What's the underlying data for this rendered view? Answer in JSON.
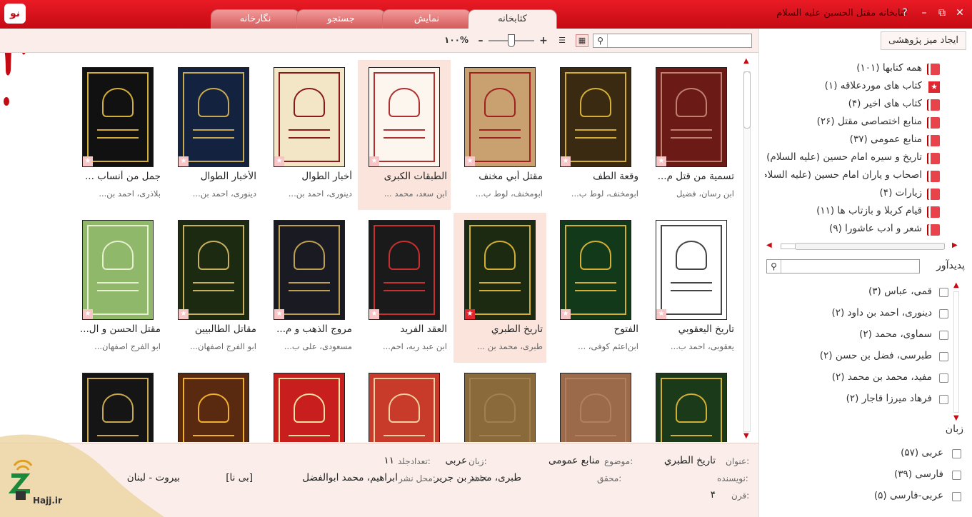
{
  "app": {
    "title": "کتابخانه مقتل الحسین علیه السلام",
    "logo_text": "نو",
    "help_icon": "?"
  },
  "tabs": [
    {
      "label": "کتابخانه",
      "active": true
    },
    {
      "label": "نمایش",
      "active": false
    },
    {
      "label": "جستجو",
      "active": false
    },
    {
      "label": "نگارخانه",
      "active": false
    }
  ],
  "toolbar": {
    "search_placeholder": "",
    "zoom": "۱۰۰%",
    "zoom_fraction": 0.45
  },
  "books": [
    {
      "title": "تسمية من قتل م...",
      "author": "ابن رسان، فضيل",
      "fav": false,
      "selected": false,
      "cover": "#6b1a16",
      "accent": "#c08070"
    },
    {
      "title": "وقعة الطف",
      "author": "ابومخنف، لوط ب...",
      "fav": false,
      "selected": false,
      "cover": "#3a2a12",
      "accent": "#d4af37"
    },
    {
      "title": "مقتل أبي مخنف",
      "author": "ابومخنف، لوط ب...",
      "fav": false,
      "selected": false,
      "cover": "#c9a070",
      "accent": "#a02020"
    },
    {
      "title": "الطبقات الكبرى",
      "author": "ابن سعد، محمد ...",
      "fav": false,
      "selected": true,
      "cover": "#fdf6ef",
      "accent": "#b03030"
    },
    {
      "title": "أخبار الطوال",
      "author": "دینوری، احمد بن...",
      "fav": false,
      "selected": false,
      "cover": "#f3e6c6",
      "accent": "#8a1a1a"
    },
    {
      "title": "الأخبار الطوال",
      "author": "دینوری، احمد بن...",
      "fav": false,
      "selected": false,
      "cover": "#13233f",
      "accent": "#c9a850"
    },
    {
      "title": "جمل من أنساب ...",
      "author": "بلاذری، احمد بن...",
      "fav": false,
      "selected": false,
      "cover": "#111111",
      "accent": "#d4af37"
    },
    {
      "title": "تاريخ اليعقوبي",
      "author": "یعقوبی، احمد ب...",
      "fav": false,
      "selected": false,
      "cover": "#ffffff",
      "accent": "#444444"
    },
    {
      "title": "الفتوح",
      "author": "ابن‌اعثم کوفی، ...",
      "fav": false,
      "selected": false,
      "cover": "#123a1a",
      "accent": "#d4af37"
    },
    {
      "title": "تاريخ الطبري",
      "author": "طبری، محمد بن ...",
      "fav": true,
      "selected": true,
      "cover": "#1c2a12",
      "accent": "#d4af37"
    },
    {
      "title": "العقد الفريد",
      "author": "ابن عبد ربه، احم...",
      "fav": false,
      "selected": false,
      "cover": "#1a1a1a",
      "accent": "#c83030"
    },
    {
      "title": "مروج الذهب و م...",
      "author": "مسعودی، علی ب...",
      "fav": false,
      "selected": false,
      "cover": "#1a1a22",
      "accent": "#bfa050"
    },
    {
      "title": "مقاتل الطالبيين",
      "author": "ابو الفرج اصفهان...",
      "fav": false,
      "selected": false,
      "cover": "#1c2a12",
      "accent": "#c9b060"
    },
    {
      "title": "مقتل الحسن و ال...",
      "author": "ابو الفرج اصفهان...",
      "fav": false,
      "selected": false,
      "cover": "#8fb86a",
      "accent": "#e8f0d0"
    },
    {
      "title": "",
      "author": "",
      "fav": false,
      "selected": false,
      "cover": "#1a3a1a",
      "accent": "#d4af37"
    },
    {
      "title": "",
      "author": "",
      "fav": false,
      "selected": false,
      "cover": "#9a6a4a",
      "accent": "#b08060"
    },
    {
      "title": "",
      "author": "",
      "fav": false,
      "selected": false,
      "cover": "#8a6a3a",
      "accent": "#a08050"
    },
    {
      "title": "",
      "author": "",
      "fav": false,
      "selected": false,
      "cover": "#c83a2a",
      "accent": "#f0d0a0"
    },
    {
      "title": "",
      "author": "",
      "fav": false,
      "selected": false,
      "cover": "#c81e1e",
      "accent": "#f4e0a0"
    },
    {
      "title": "",
      "author": "",
      "fav": false,
      "selected": false,
      "cover": "#5a2a10",
      "accent": "#f0b030"
    },
    {
      "title": "",
      "author": "",
      "fav": false,
      "selected": false,
      "cover": "#151515",
      "accent": "#c9a850"
    }
  ],
  "details": {
    "title_label": "عنوان:",
    "title_value": "تاريخ الطبري",
    "subject_label": "موضوع:",
    "subject_value": "منابع عمومی",
    "lang_label": "زبان:",
    "lang_value": "عربی",
    "vols_label": "تعدادجلد:",
    "vols_value": "۱۱",
    "author_label": "نویسنده:",
    "author_value": "طبری، محمد بن جریر",
    "editor_label": "محقق:",
    "editor_value": "ابراهیم، محمد ابوالفضل",
    "publisher_label": "ناشر:",
    "publisher_value": "[بی نا]",
    "place_label": "محل نشر:",
    "place_value": "بیروت - لبنان",
    "century_label": "قرن:",
    "century_value": "۴",
    "site_text": "Hajj.ir"
  },
  "sidebar": {
    "create_desk": "ایجاد میز پژوهشی",
    "categories": [
      {
        "label": "همه کتابها (۱۰۱)",
        "icon": "books-icon"
      },
      {
        "label": "کتاب های موردعلاقه (۱)",
        "icon": "star-icon"
      },
      {
        "label": "کتاب های اخیر (۴)",
        "icon": "books-icon"
      },
      {
        "label": "منابع اختصاصی مقتل (۲۶)",
        "icon": "books-icon"
      },
      {
        "label": "منابع عمومی (۳۷)",
        "icon": "books-icon"
      },
      {
        "label": "تاریخ و سیره امام حسین (علیه السلام) (",
        "icon": "books-icon"
      },
      {
        "label": "اصحاب و یاران امام حسین (علیه السلام)",
        "icon": "books-icon"
      },
      {
        "label": "زیارات (۴)",
        "icon": "books-icon"
      },
      {
        "label": "قیام کربلا و بازتاب ها (۱۱)",
        "icon": "books-icon"
      },
      {
        "label": "شعر و ادب عاشورا (۹)",
        "icon": "books-icon"
      }
    ],
    "author_heading": "پدیدآور",
    "authors": [
      {
        "label": "قمی، عباس (۳)"
      },
      {
        "label": "دینوری، احمد بن داود (۲)"
      },
      {
        "label": "سماوی، محمد (۲)"
      },
      {
        "label": "طبرسی، فضل بن حسن (۲)"
      },
      {
        "label": "مفید، محمد بن محمد (۲)"
      },
      {
        "label": "فرهاد میرزا قاجار (۲)"
      }
    ],
    "lang_heading": "زبان",
    "languages": [
      {
        "label": "عربی (۵۷)"
      },
      {
        "label": "فارسی (۳۹)"
      },
      {
        "label": "عربی-فارسی (۵)"
      }
    ]
  }
}
